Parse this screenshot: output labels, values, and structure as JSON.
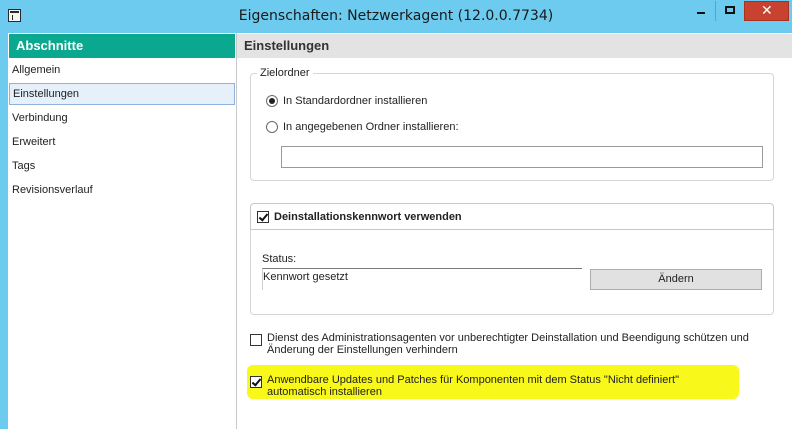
{
  "window": {
    "title": "Eigenschaften: Netzwerkagent (12.0.0.7734)",
    "controls": {
      "minimize": "minimize-icon",
      "maximize": "maximize-icon",
      "close": "✕"
    }
  },
  "sidebar": {
    "header": "Abschnitte",
    "items": [
      {
        "label": "Allgemein"
      },
      {
        "label": "Einstellungen",
        "selected": true
      },
      {
        "label": "Verbindung"
      },
      {
        "label": "Erweitert"
      },
      {
        "label": "Tags"
      },
      {
        "label": "Revisionsverlauf"
      }
    ]
  },
  "main": {
    "header": "Einstellungen",
    "folder_group": {
      "legend": "Zielordner",
      "radio_default": {
        "label": "In Standardordner installieren",
        "checked": true
      },
      "radio_custom": {
        "label": "In angegebenen Ordner installieren:",
        "checked": false
      },
      "path_value": ""
    },
    "password": {
      "checkbox_label": "Deinstallationskennwort verwenden",
      "checked": true,
      "status_label": "Status:",
      "status_value": "Kennwort gesetzt",
      "change_button": "Ändern"
    },
    "protect": {
      "label": "Dienst des Administrationsagenten vor unberechtigter Deinstallation und Beendigung schützen und Änderung der Einstellungen verhindern",
      "checked": false
    },
    "updates": {
      "label": "Anwendbare Updates und Patches für Komponenten mit dem Status \"Nicht definiert\" automatisch installieren",
      "checked": true,
      "highlight_color": "#f8f81a"
    }
  },
  "colors": {
    "titlebar": "#6ccbee",
    "sidebar_header": "#0aa98f",
    "close_button": "#c7432f",
    "selected_item": "#e6f0fa"
  }
}
